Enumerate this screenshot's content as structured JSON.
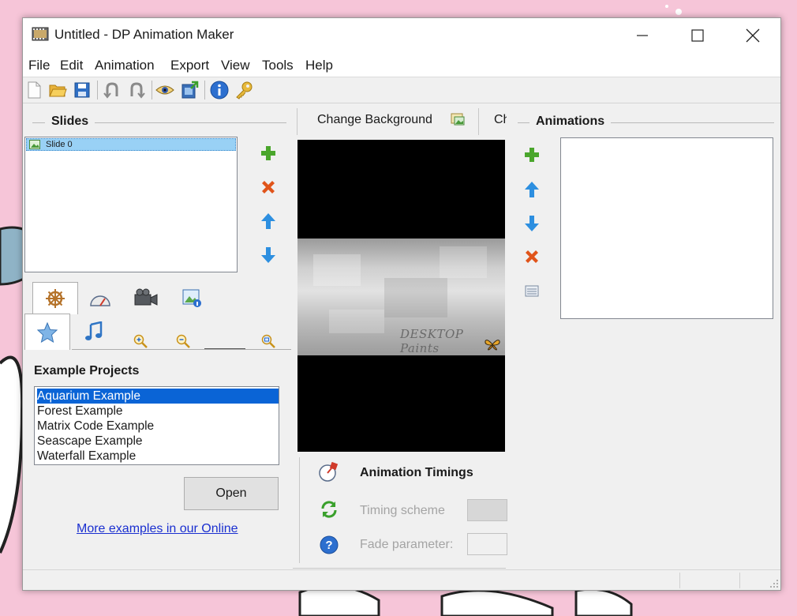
{
  "window": {
    "title": "Untitled - DP Animation Maker"
  },
  "menu": [
    "File",
    "Edit",
    "Animation",
    "Export",
    "View",
    "Tools",
    "Help"
  ],
  "toolbar_icons": [
    "new-file-icon",
    "open-folder-icon",
    "save-icon",
    "undo-icon",
    "redo-icon",
    "preview-eye-icon",
    "export-film-icon",
    "info-icon",
    "key-icon"
  ],
  "slides": {
    "heading": "Slides",
    "items": [
      "Slide 0"
    ]
  },
  "preview_toolbar": {
    "change_background": "Change Background",
    "truncated_button": "Ch"
  },
  "preview": {
    "watermark": "DESKTOP Paints"
  },
  "animations": {
    "heading": "Animations"
  },
  "examples": {
    "heading": "Example Projects",
    "items": [
      "Aquarium Example",
      "Forest Example",
      "Matrix Code Example",
      "Seascape Example",
      "Waterfall Example"
    ],
    "selected_index": 0,
    "open_label": "Open",
    "more_link": "More examples in our Online"
  },
  "timings": {
    "heading": "Animation Timings",
    "timing_scheme_label": "Timing scheme",
    "fade_parameter_label": "Fade parameter:"
  },
  "colors": {
    "selection": "#0a64d6",
    "link": "#1a2fd0",
    "add_green": "#4aa62c",
    "delete_orange": "#e0541a",
    "arrow_blue": "#2d8fe0"
  }
}
